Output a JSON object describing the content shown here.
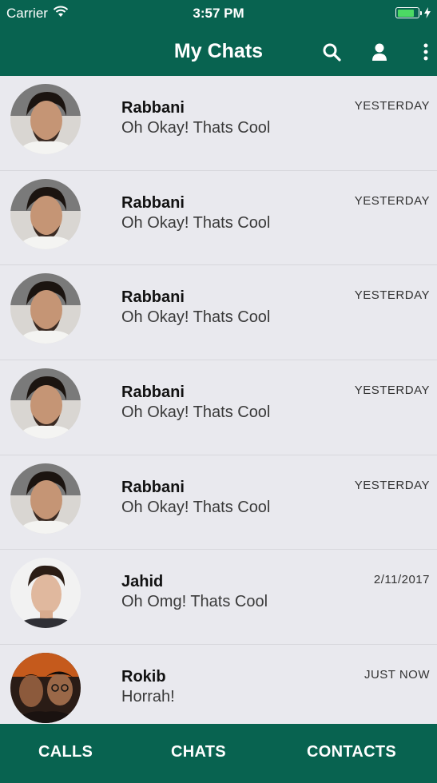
{
  "status_bar": {
    "carrier": "Carrier",
    "time": "3:57 PM",
    "wifi_icon": "wifi-icon",
    "battery_icon": "battery-charging-icon",
    "battery_color": "#4cd964"
  },
  "header": {
    "title": "My Chats",
    "actions": [
      "search-icon",
      "user-icon",
      "more-vertical-icon"
    ],
    "background": "#086350"
  },
  "chats": [
    {
      "name": "Rabbani",
      "message": "Oh Okay! Thats Cool",
      "time": "YESTERDAY",
      "avatar": "person-photo-1"
    },
    {
      "name": "Rabbani",
      "message": "Oh Okay! Thats Cool",
      "time": "YESTERDAY",
      "avatar": "person-photo-1"
    },
    {
      "name": "Rabbani",
      "message": "Oh Okay! Thats Cool",
      "time": "YESTERDAY",
      "avatar": "person-photo-1"
    },
    {
      "name": "Rabbani",
      "message": "Oh Okay! Thats Cool",
      "time": "YESTERDAY",
      "avatar": "person-photo-1"
    },
    {
      "name": "Rabbani",
      "message": "Oh Okay! Thats Cool",
      "time": "YESTERDAY",
      "avatar": "person-photo-1"
    },
    {
      "name": "Jahid",
      "message": "Oh Omg! Thats Cool",
      "time": "2/11/2017",
      "avatar": "person-photo-2"
    },
    {
      "name": "Rokib",
      "message": "Horrah!",
      "time": "JUST NOW",
      "avatar": "person-photo-3"
    }
  ],
  "tabs": [
    {
      "label": "CALLS"
    },
    {
      "label": "CHATS"
    },
    {
      "label": "CONTACTS"
    }
  ]
}
